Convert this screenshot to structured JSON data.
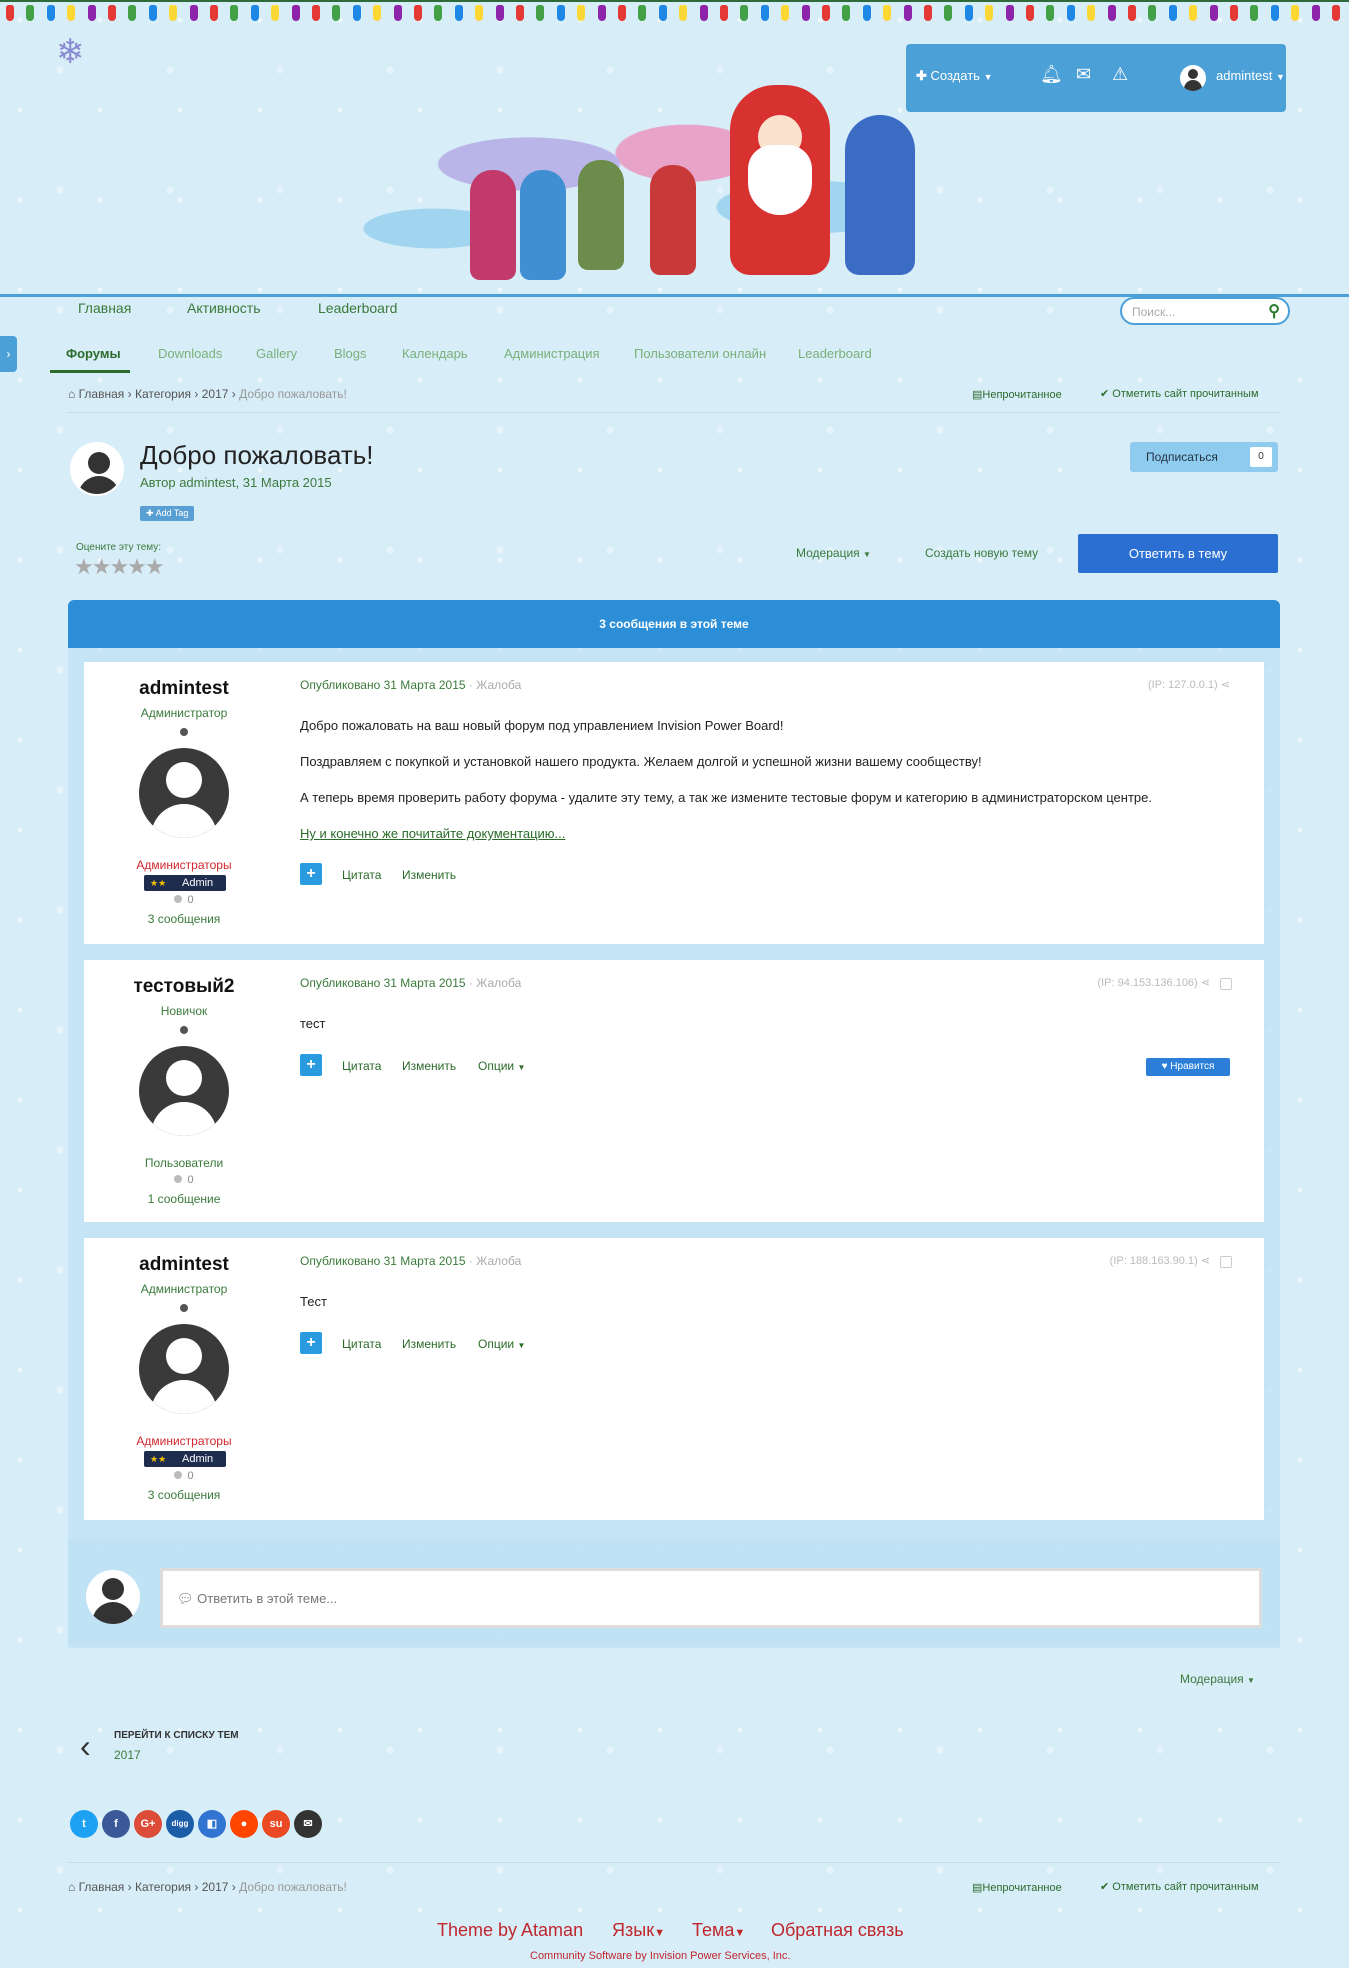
{
  "header": {
    "create_label": "Создать",
    "username": "admintest",
    "icons": [
      "plus-icon",
      "bell-icon",
      "envelope-icon",
      "warning-icon",
      "caret-down-icon"
    ]
  },
  "nav": {
    "top": [
      "Главная",
      "Активность",
      "Leaderboard"
    ],
    "sub": [
      "Форумы",
      "Downloads",
      "Gallery",
      "Blogs",
      "Календарь",
      "Администрация",
      "Пользователи онлайн",
      "Leaderboard"
    ],
    "search_placeholder": "Поиск..."
  },
  "breadcrumb": {
    "items": [
      "Главная",
      "Категория",
      "2017"
    ],
    "current": "Добро пожаловать!",
    "unread": "Непрочитанное",
    "mark_read": "Отметить сайт прочитанным"
  },
  "topic": {
    "title": "Добро пожаловать!",
    "author_prefix": "Автор",
    "author": "admintest",
    "date": "31 Марта 2015",
    "add_tag": "Add Tag",
    "subscribe": "Подписаться",
    "subscribe_count": "0",
    "rate_label": "Оцените эту тему:",
    "rating": 0,
    "moderation": "Модерация",
    "new_topic": "Создать новую тему",
    "reply": "Ответить в тему",
    "posts_count_label": "3 сообщения в этой теме"
  },
  "posts": [
    {
      "username": "admintest",
      "rank": "Администратор",
      "group": "Администраторы",
      "badge": "Admin",
      "reputation": "0",
      "post_count": "3 сообщения",
      "date": "Опубликовано 31 Марта 2015",
      "report": "Жалоба",
      "ip": "(IP: 127.0.0.1)",
      "lines": [
        "Добро пожаловать на ваш новый форум под управлением Invision Power Board!",
        "Поздравляем с покупкой и установкой нашего продукта. Желаем долгой и успешной жизни вашему сообществу!",
        "А теперь время проверить работу форума - удалите эту тему, а так же измените тестовые форум и категорию в администраторском центре."
      ],
      "link": "Ну и конечно же почитайте документацию...",
      "quote": "Цитата",
      "edit": "Изменить"
    },
    {
      "username": "тестовый2",
      "rank": "Новичок",
      "group": "Пользователи",
      "reputation": "0",
      "post_count": "1 сообщение",
      "date": "Опубликовано 31 Марта 2015",
      "report": "Жалоба",
      "ip": "(IP: 94.153.136.106)",
      "text": "тест",
      "quote": "Цитата",
      "edit": "Изменить",
      "options": "Опции",
      "like": "Нравится"
    },
    {
      "username": "admintest",
      "rank": "Администратор",
      "group": "Администраторы",
      "badge": "Admin",
      "reputation": "0",
      "post_count": "3 сообщения",
      "date": "Опубликовано 31 Марта 2015",
      "report": "Жалоба",
      "ip": "(IP: 188.163.90.1)",
      "text": "Тест",
      "quote": "Цитата",
      "edit": "Изменить",
      "options": "Опции"
    }
  ],
  "reply_placeholder": "Ответить в этой теме...",
  "bottom": {
    "moderation": "Модерация",
    "back_label": "ПЕРЕЙТИ К СПИСКУ ТЕМ",
    "back_forum": "2017",
    "share_icons": [
      "twitter-icon",
      "facebook-icon",
      "google-plus-icon",
      "digg-icon",
      "delicious-icon",
      "reddit-icon",
      "stumbleupon-icon",
      "email-icon"
    ]
  },
  "footer": {
    "theme": "Theme by Ataman",
    "language": "Язык",
    "theme_menu": "Тема",
    "feedback": "Обратная связь",
    "copyright": "Community Software by Invision Power Services, Inc."
  }
}
